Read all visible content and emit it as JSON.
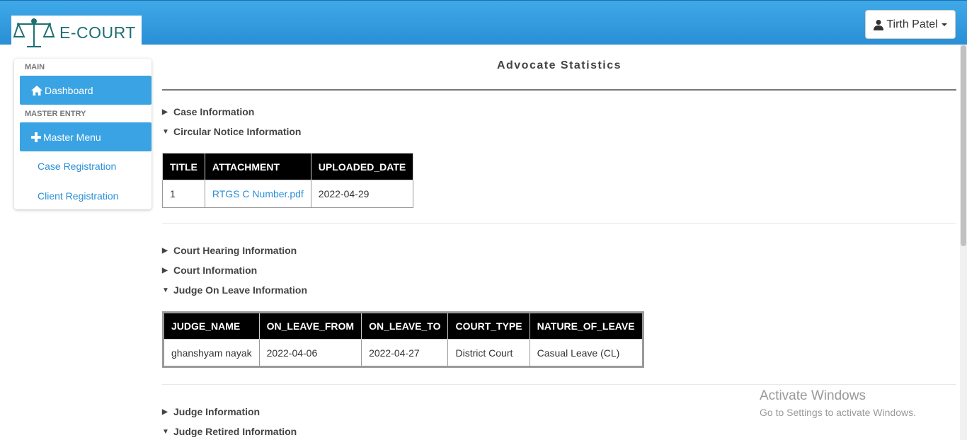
{
  "header": {
    "logo_text": "E-COURT",
    "user_name": "Tirth Patel"
  },
  "sidebar": {
    "main_heading": "MAIN",
    "dashboard_label": "Dashboard",
    "master_heading": "MASTER ENTRY",
    "master_menu_label": "Master Menu",
    "links": [
      "Case Registration",
      "Client Registration"
    ]
  },
  "main": {
    "page_title": "Advocate Statistics",
    "sections": [
      {
        "label": "Case Information",
        "expanded": false
      },
      {
        "label": "Circular Notice Information",
        "expanded": true
      },
      {
        "label": "Court Hearing Information",
        "expanded": false
      },
      {
        "label": "Court Information",
        "expanded": false
      },
      {
        "label": "Judge On Leave Information",
        "expanded": true
      },
      {
        "label": "Judge Information",
        "expanded": false
      },
      {
        "label": "Judge Retired Information",
        "expanded": true
      }
    ],
    "circular_table": {
      "headers": [
        "TITLE",
        "ATTACHMENT",
        "UPLOADED_DATE"
      ],
      "rows": [
        [
          "1",
          "RTGS C Number.pdf",
          "2022-04-29"
        ]
      ]
    },
    "leave_table": {
      "headers": [
        "JUDGE_NAME",
        "ON_LEAVE_FROM",
        "ON_LEAVE_TO",
        "COURT_TYPE",
        "NATURE_OF_LEAVE"
      ],
      "rows": [
        [
          "ghanshyam nayak",
          "2022-04-06",
          "2022-04-27",
          "District Court",
          "Casual Leave (CL)"
        ]
      ]
    }
  },
  "watermark": {
    "line1": "Activate Windows",
    "line2": "Go to Settings to activate Windows."
  },
  "colors": {
    "header_blue": "#3fa9e8",
    "sidebar_button": "#3aa3e3",
    "link": "#2a8fd6",
    "table_header": "#000000"
  },
  "icons": {
    "logo": "scales-of-justice-icon",
    "user": "user-icon",
    "dashboard": "home-icon",
    "master_menu": "plus-icon"
  }
}
